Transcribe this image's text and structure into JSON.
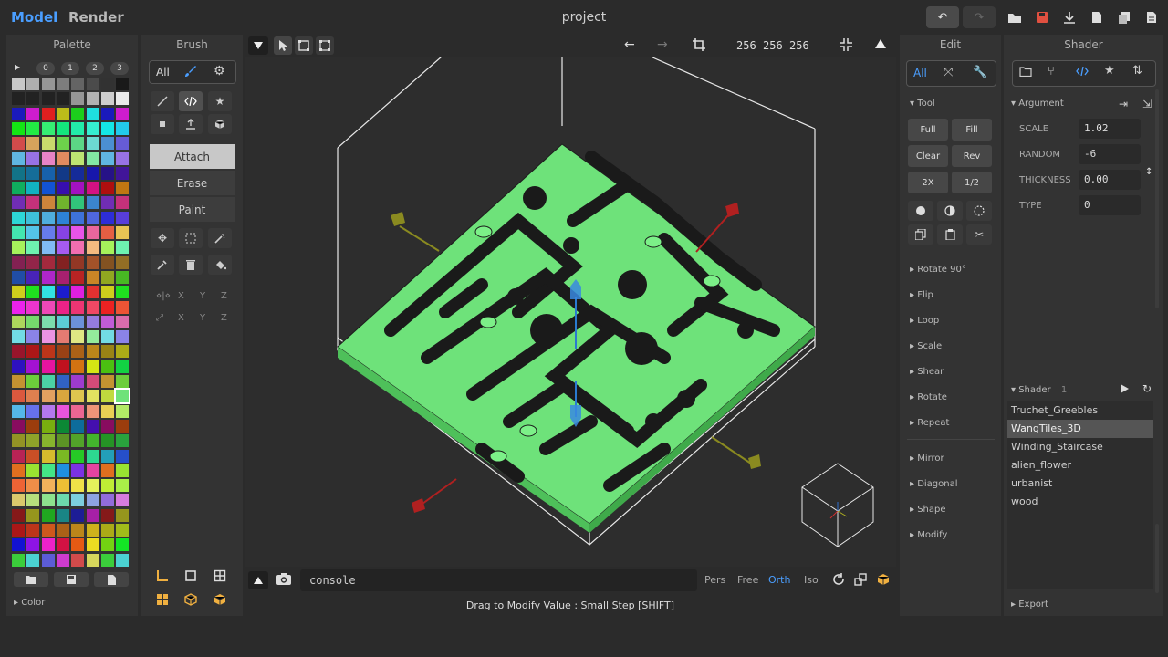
{
  "topbar": {
    "tabs": [
      {
        "label": "Model"
      },
      {
        "label": "Render"
      }
    ],
    "project_title": "project"
  },
  "palette": {
    "title": "Palette",
    "page_tabs": [
      "0",
      "1",
      "2",
      "3"
    ],
    "section_label": "Color"
  },
  "brush": {
    "title": "Brush",
    "all_label": "All",
    "modes": [
      "Attach",
      "Erase",
      "Paint"
    ],
    "mirror_rows": [
      [
        "X",
        "Y",
        "Z"
      ],
      [
        "X",
        "Y",
        "Z"
      ]
    ]
  },
  "viewport": {
    "dims": [
      "256",
      "256",
      "256"
    ],
    "console_placeholder": "console",
    "camera_modes": [
      "Pers",
      "Free",
      "Orth",
      "Iso"
    ],
    "active_camera": "Orth",
    "status_text": "Drag to Modify Value : Small Step [SHIFT]"
  },
  "edit": {
    "title": "Edit",
    "all_label": "All",
    "tool_section": "Tool",
    "tool_buttons": [
      "Full",
      "Fill",
      "Clear",
      "Rev",
      "2X",
      "1/2"
    ],
    "sections": [
      "Rotate 90°",
      "Flip",
      "Loop",
      "Scale",
      "Shear",
      "Rotate",
      "Repeat",
      "Mirror",
      "Diagonal",
      "Shape",
      "Modify"
    ]
  },
  "shader": {
    "title": "Shader",
    "argument_section": "Argument",
    "arguments": [
      {
        "name": "SCALE",
        "value": "1.02"
      },
      {
        "name": "RANDOM",
        "value": "-6"
      },
      {
        "name": "THICKNESS",
        "value": "0.00"
      },
      {
        "name": "TYPE",
        "value": "0"
      }
    ],
    "list_section": "Shader",
    "list_count": "1",
    "items": [
      "Truchet_Greebles",
      "WangTiles_3D",
      "Winding_Staircase",
      "alien_flower",
      "urbanist",
      "wood"
    ],
    "selected": "WangTiles_3D",
    "export_label": "Export"
  },
  "colors": {
    "accent": "#4a9eff",
    "voxel_green": "#6ee27a",
    "orange_icon": "#f0b040",
    "save_red": "#e05040"
  }
}
